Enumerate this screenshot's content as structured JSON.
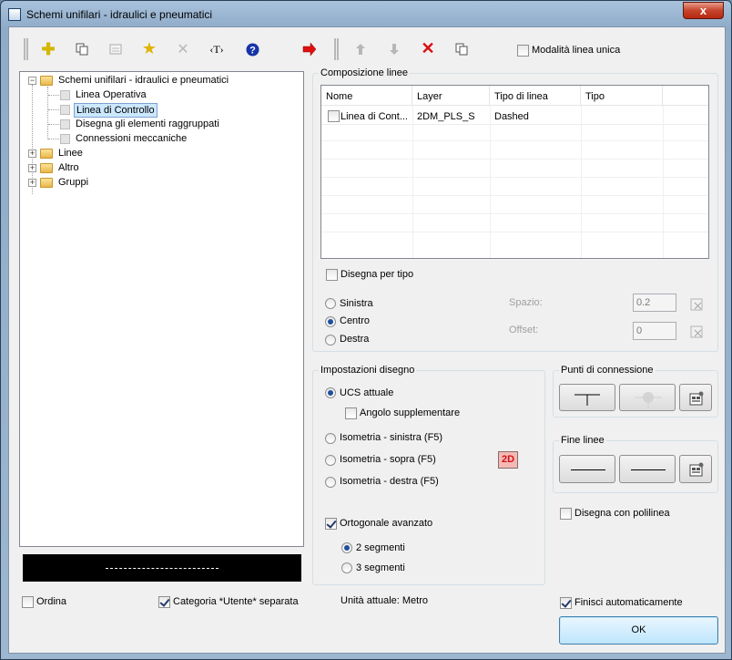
{
  "window": {
    "title": "Schemi unifilari - idraulici e pneumatici",
    "close": "x"
  },
  "toolbar": {
    "modalita_label": "Modalità linea unica"
  },
  "tree": {
    "root": "Schemi unifilari - idraulici e pneumatici",
    "children": [
      "Linea Operativa",
      "Linea di Controllo",
      "Disegna gli elementi raggruppati",
      "Connessioni meccaniche"
    ],
    "others": [
      "Linee",
      "Altro",
      "Gruppi"
    ]
  },
  "composizione": {
    "title": "Composizione linee",
    "columns": [
      "Nome",
      "Layer",
      "Tipo di linea",
      "Tipo"
    ],
    "rows": [
      {
        "nome": "Linea di Cont...",
        "layer": "2DM_PLS_S",
        "tipo_linea": "Dashed",
        "tipo": ""
      }
    ],
    "disegna_per_tipo": "Disegna per tipo",
    "radios": [
      "Sinistra",
      "Centro",
      "Destra"
    ],
    "spazio_label": "Spazio:",
    "spazio_value": "0.2",
    "offset_label": "Offset:",
    "offset_value": "0"
  },
  "impostazioni": {
    "title": "Impostazioni disegno",
    "ucs": "UCS attuale",
    "angolo": "Angolo supplementare",
    "iso_sx": "Isometria - sinistra (F5)",
    "iso_sopra": "Isometria - sopra (F5)",
    "iso_dx": "Isometria - destra (F5)",
    "badge": "2D",
    "ortogonale": "Ortogonale avanzato",
    "seg2": "2 segmenti",
    "seg3": "3 segmenti"
  },
  "punti": {
    "title": "Punti di connessione"
  },
  "fine": {
    "title": "Fine linee"
  },
  "polilinea": "Disegna con polilinea",
  "bottom": {
    "ordina": "Ordina",
    "categoria": "Categoria *Utente* separata",
    "unita": "Unità attuale: Metro",
    "finisci": "Finisci automaticamente",
    "ok": "OK"
  },
  "colors": {
    "accent": "#1f4f9e",
    "badge_bg": "#f4b9b5",
    "badge_text": "#d0121a",
    "selection": "#cce8ff"
  }
}
